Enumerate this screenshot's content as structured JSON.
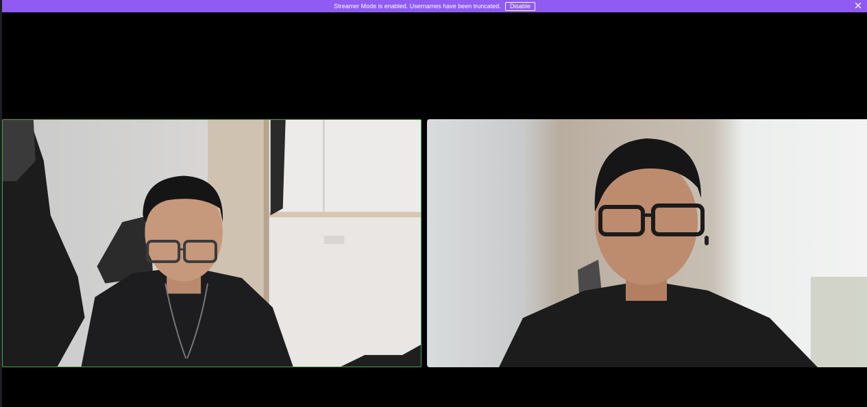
{
  "notice": {
    "message": "Streamer Mode is enabled. Usernames have been truncated.",
    "disable_label": "Disable",
    "close_icon": "close-icon",
    "background_color": "#8f5bf2"
  },
  "call": {
    "participants": [
      {
        "slot": "left",
        "speaking": true,
        "speaking_border_color": "#3fa94f"
      },
      {
        "slot": "right",
        "speaking": false
      }
    ]
  }
}
